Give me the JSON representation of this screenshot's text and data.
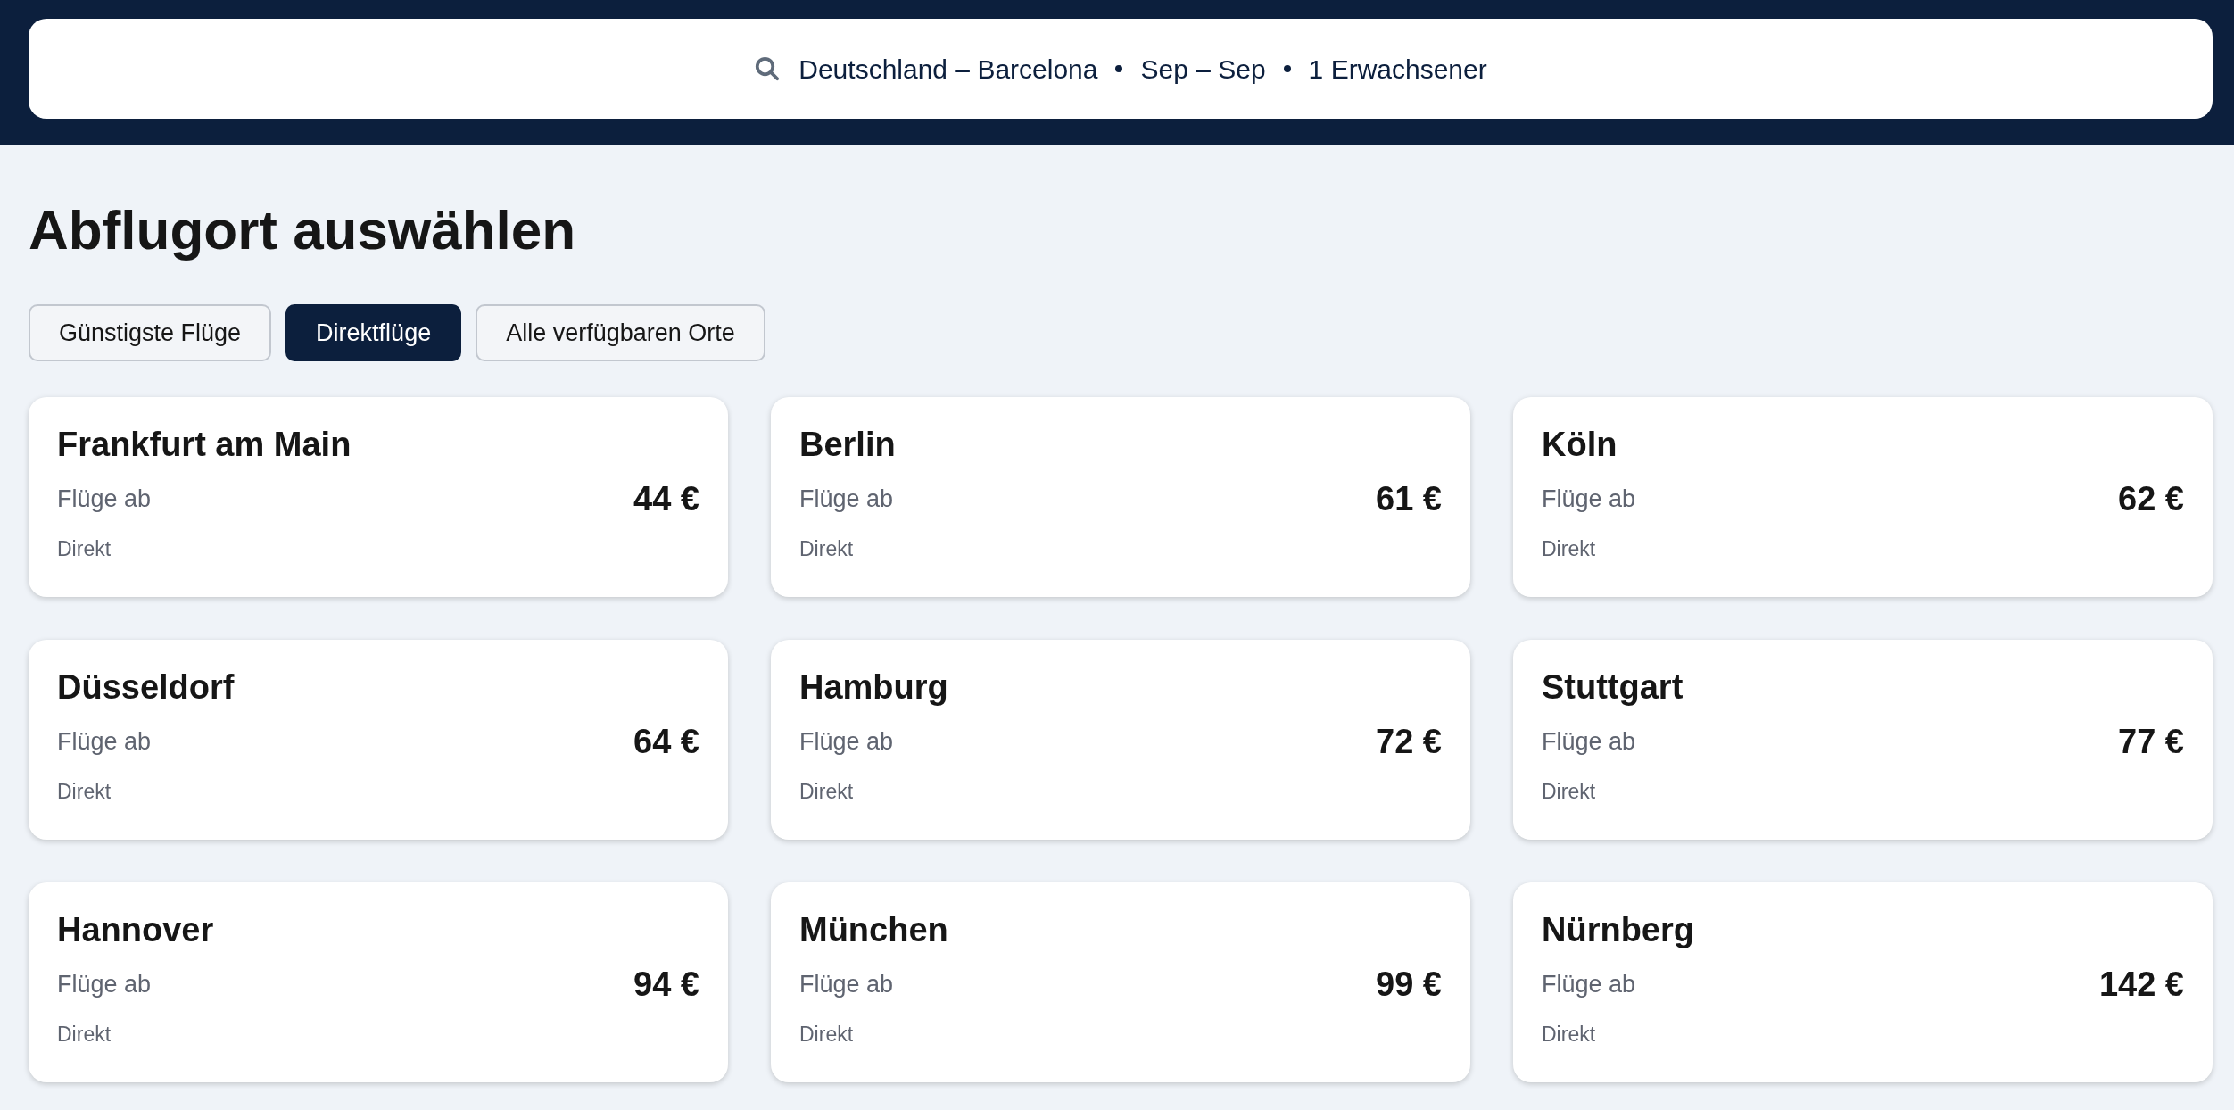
{
  "search": {
    "parts": [
      "Deutschland – Barcelona",
      "Sep – Sep",
      "1 Erwachsener"
    ]
  },
  "title": "Abflugort auswählen",
  "filters": [
    {
      "label": "Günstigste Flüge",
      "selected": false
    },
    {
      "label": "Direktflüge",
      "selected": true
    },
    {
      "label": "Alle verfügbaren Orte",
      "selected": false
    }
  ],
  "destinations": [
    {
      "city": "Frankfurt am Main",
      "from_label": "Flüge ab",
      "price": "44 €",
      "stops": "Direkt"
    },
    {
      "city": "Berlin",
      "from_label": "Flüge ab",
      "price": "61 €",
      "stops": "Direkt"
    },
    {
      "city": "Köln",
      "from_label": "Flüge ab",
      "price": "62 €",
      "stops": "Direkt"
    },
    {
      "city": "Düsseldorf",
      "from_label": "Flüge ab",
      "price": "64 €",
      "stops": "Direkt"
    },
    {
      "city": "Hamburg",
      "from_label": "Flüge ab",
      "price": "72 €",
      "stops": "Direkt"
    },
    {
      "city": "Stuttgart",
      "from_label": "Flüge ab",
      "price": "77 €",
      "stops": "Direkt"
    },
    {
      "city": "Hannover",
      "from_label": "Flüge ab",
      "price": "94 €",
      "stops": "Direkt"
    },
    {
      "city": "München",
      "from_label": "Flüge ab",
      "price": "99 €",
      "stops": "Direkt"
    },
    {
      "city": "Nürnberg",
      "from_label": "Flüge ab",
      "price": "142 €",
      "stops": "Direkt"
    }
  ]
}
